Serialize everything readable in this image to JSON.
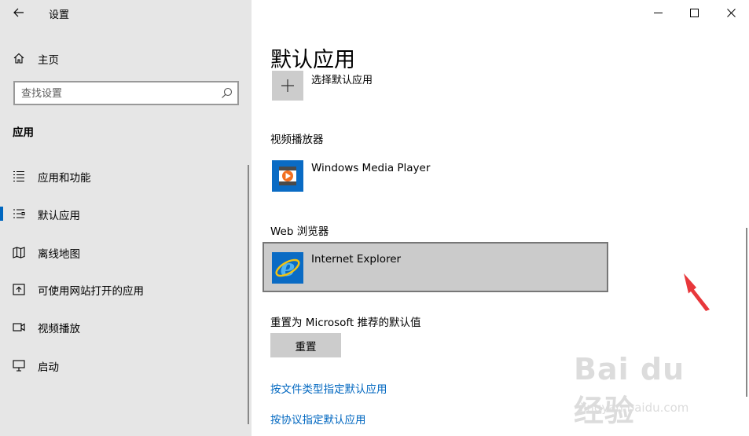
{
  "window": {
    "title": "设置"
  },
  "sidebar": {
    "home_label": "主页",
    "search_placeholder": "查找设置",
    "section_heading": "应用",
    "items": [
      {
        "label": "应用和功能",
        "icon": "list-icon"
      },
      {
        "label": "默认应用",
        "icon": "default-apps-icon",
        "selected": true
      },
      {
        "label": "离线地图",
        "icon": "map-icon"
      },
      {
        "label": "可使用网站打开的应用",
        "icon": "open-website-icon"
      },
      {
        "label": "视频播放",
        "icon": "video-icon"
      },
      {
        "label": "启动",
        "icon": "startup-icon"
      }
    ]
  },
  "main": {
    "title": "默认应用",
    "choose_default_label": "选择默认应用",
    "video_player": {
      "heading": "视频播放器",
      "app_name": "Windows Media Player"
    },
    "web_browser": {
      "heading": "Web 浏览器",
      "app_name": "Internet Explorer"
    },
    "reset": {
      "heading": "重置为 Microsoft 推荐的默认值",
      "button_label": "重置"
    },
    "links": [
      "按文件类型指定默认应用",
      "按协议指定默认应用"
    ]
  },
  "watermark": {
    "logo_text": "Bai du 经验",
    "url": "jingyan.baidu.com"
  },
  "colors": {
    "accent": "#0067c0",
    "sidebar_bg": "#e6e6e6",
    "selected_tile_bg": "#cbcbcb",
    "annotation_arrow": "#e8373b"
  }
}
